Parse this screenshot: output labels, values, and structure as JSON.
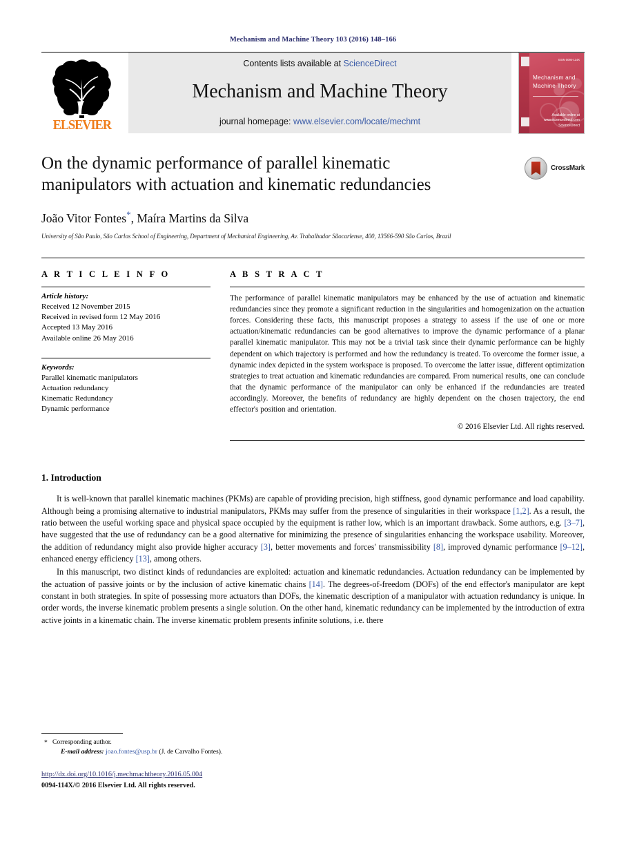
{
  "running_head": "Mechanism and Machine Theory 103 (2016) 148–166",
  "masthead": {
    "contents_prefix": "Contents lists available at ",
    "sciencedirect": "ScienceDirect",
    "journal_title": "Mechanism and Machine Theory",
    "homepage_label": "journal homepage: ",
    "homepage_url": "www.elsevier.com/locate/mechmt",
    "publisher": "ELSEVIER",
    "cover": {
      "title_line1": "Mechanism and",
      "title_line2": "Machine Theory",
      "top_note": "ISSN 0094-114X",
      "foot_note": "Available online at www.sciencedirect.com",
      "foot_brand": "ScienceDirect"
    },
    "colors": {
      "banner_bg": "#e9e9e9",
      "link": "#3b5ca8",
      "elsevier_orange": "#ef7d1a",
      "cover_red": "#c34356"
    }
  },
  "article": {
    "title": "On the dynamic performance of parallel kinematic manipulators with actuation and kinematic redundancies",
    "authors": "João Vitor Fontes",
    "author_marker": "*",
    "authors_second": ", Maíra Martins da Silva",
    "affiliation": "University of São Paulo, São Carlos School of Engineering, Department of Mechanical Engineering, Av. Trabalhador Sãocarlense, 400, 13566-590 São Carlos, Brazil",
    "crossmark_label": "CrossMark"
  },
  "info": {
    "heading": "A R T I C L E   I N F O",
    "history_label": "Article history:",
    "history": [
      "Received 12 November 2015",
      "Received in revised form 12 May 2016",
      "Accepted 13 May 2016",
      "Available online 26 May 2016"
    ],
    "keywords_label": "Keywords:",
    "keywords": [
      "Parallel kinematic manipulators",
      "Actuation redundancy",
      "Kinematic Redundancy",
      "Dynamic performance"
    ]
  },
  "abstract": {
    "heading": "A B S T R A C T",
    "text": "The performance of parallel kinematic manipulators may be enhanced by the use of actuation and kinematic redundancies since they promote a significant reduction in the singularities and homogenization on the actuation forces. Considering these facts, this manuscript proposes a strategy to assess if the use of one or more actuation/kinematic redundancies can be good alternatives to improve the dynamic performance of a planar parallel kinematic manipulator. This may not be a trivial task since their dynamic performance can be highly dependent on which trajectory is performed and how the redundancy is treated. To overcome the former issue, a dynamic index depicted in the system workspace is proposed. To overcome the latter issue, different optimization strategies to treat actuation and kinematic redundancies are compared. From numerical results, one can conclude that the dynamic performance of the manipulator can only be enhanced if the redundancies are treated accordingly. Moreover, the benefits of redundancy are highly dependent on the chosen trajectory, the end effector's position and orientation.",
    "copyright": "© 2016 Elsevier Ltd. All rights reserved."
  },
  "body": {
    "section_number_title": "1.  Introduction",
    "paragraph_1_a": "It is well-known that parallel kinematic machines (PKMs) are capable of providing precision, high stiffness, good dynamic performance and load capability. Although being a promising alternative to industrial manipulators, PKMs may suffer from the presence of singularities in their workspace ",
    "ref_1_2": "[1,2]",
    "paragraph_1_b": ". As a result, the ratio between the useful working space and physical space occupied by the equipment is rather low, which is an important drawback. Some authors, e.g. ",
    "ref_3_7": "[3–7]",
    "paragraph_1_c": ", have suggested that the use of redundancy can be a good alternative for minimizing the presence of singularities enhancing the workspace usability. Moreover, the addition of redundancy might also provide higher accuracy ",
    "ref_3": "[3]",
    "paragraph_1_d": ", better movements and forces' transmissibility ",
    "ref_8": "[8]",
    "paragraph_1_e": ", improved dynamic performance ",
    "ref_9_12": "[9–12]",
    "paragraph_1_f": ", enhanced energy efficiency ",
    "ref_13": "[13]",
    "paragraph_1_g": ", among others.",
    "paragraph_2_a": "In this manuscript, two distinct kinds of redundancies are exploited: actuation and kinematic redundancies. Actuation redundancy can be implemented by the actuation of passive joints or by the inclusion of active kinematic chains ",
    "ref_14": "[14]",
    "paragraph_2_b": ". The degrees-of-freedom (DOFs) of the end effector's manipulator are kept constant in both strategies. In spite of possessing more actuators than DOFs, the kinematic description of a manipulator with actuation redundancy is unique. In order words, the inverse kinematic problem presents a single solution. On the other hand, kinematic redundancy can be implemented by the introduction of extra active joints in a kinematic chain. The inverse kinematic problem presents infinite solutions, i.e. there"
  },
  "footnote": {
    "star": "*",
    "corresponding": "Corresponding author.",
    "email_label": "E-mail address:",
    "email": "joao.fontes@usp.br",
    "email_suffix": "(J. de Carvalho Fontes)."
  },
  "page_footer": {
    "doi": "http://dx.doi.org/10.1016/j.mechmachtheory.2016.05.004",
    "issn_line": "0094-114X/© 2016 Elsevier Ltd. All rights reserved."
  }
}
